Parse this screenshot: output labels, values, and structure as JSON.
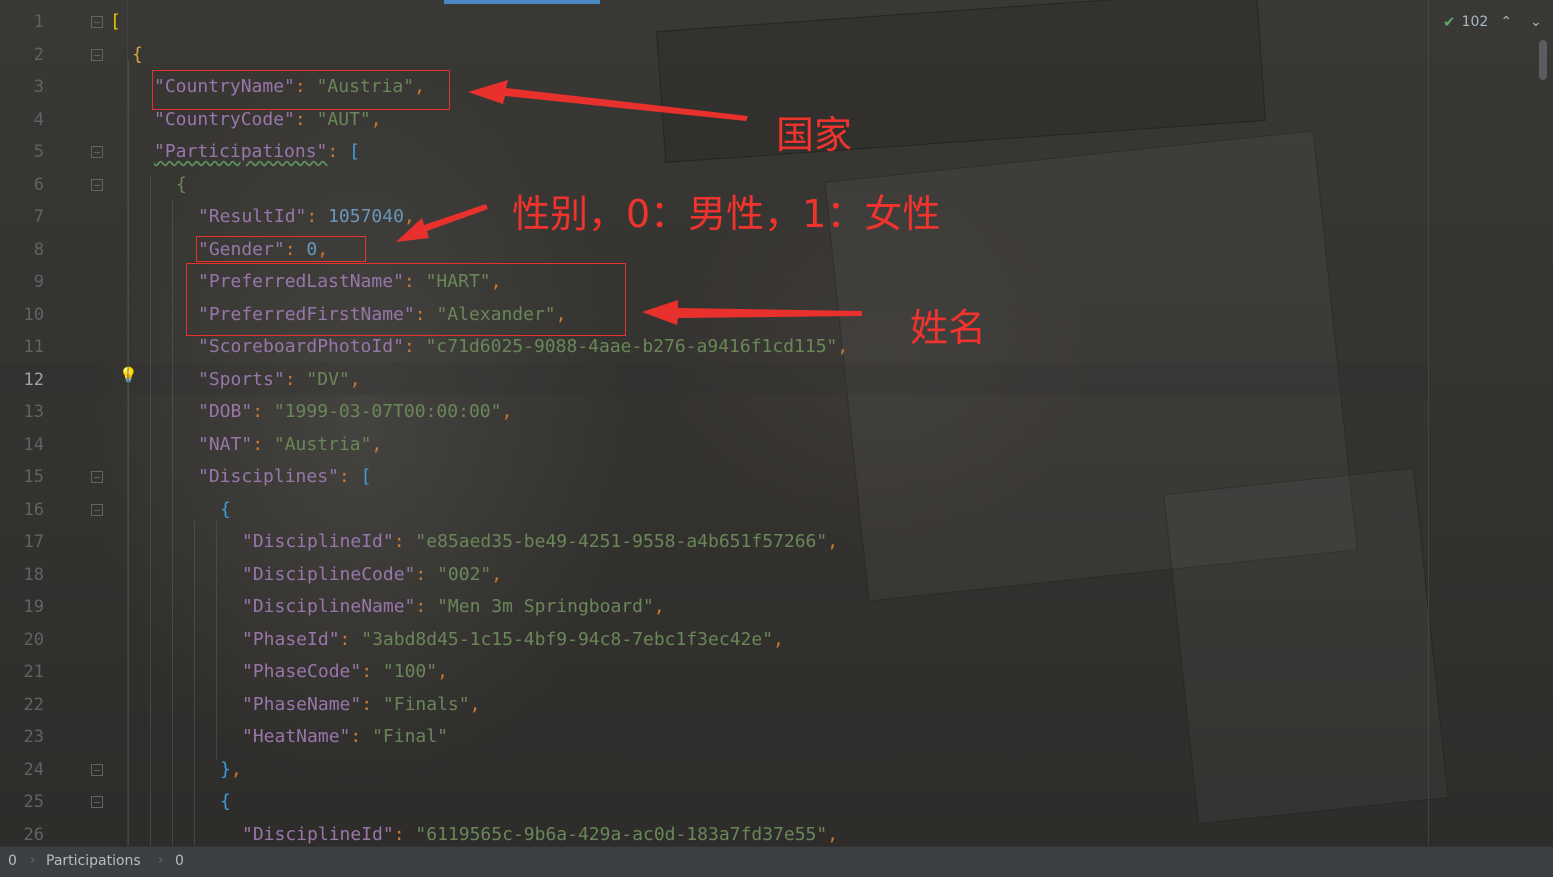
{
  "editor": {
    "line_numbers": [
      "1",
      "2",
      "3",
      "4",
      "5",
      "6",
      "7",
      "8",
      "9",
      "10",
      "11",
      "12",
      "13",
      "14",
      "15",
      "16",
      "17",
      "18",
      "19",
      "20",
      "21",
      "22",
      "23",
      "24",
      "25",
      "26"
    ],
    "current_line": "12",
    "lines": [
      {
        "indent": 0,
        "tokens": [
          {
            "t": "[",
            "c": "bracket-0"
          }
        ]
      },
      {
        "indent": 1,
        "tokens": [
          {
            "t": "{",
            "c": "bracket-1"
          }
        ]
      },
      {
        "indent": 2,
        "tokens": [
          {
            "t": "\"CountryName\"",
            "c": "key"
          },
          {
            "t": ": ",
            "c": "punct"
          },
          {
            "t": "\"Austria\"",
            "c": "str"
          },
          {
            "t": ",",
            "c": "punct"
          }
        ]
      },
      {
        "indent": 2,
        "tokens": [
          {
            "t": "\"CountryCode\"",
            "c": "key"
          },
          {
            "t": ": ",
            "c": "punct"
          },
          {
            "t": "\"AUT\"",
            "c": "str"
          },
          {
            "t": ",",
            "c": "punct"
          }
        ]
      },
      {
        "indent": 2,
        "tokens": [
          {
            "t": "\"Participations\"",
            "c": "key squiggle"
          },
          {
            "t": ": ",
            "c": "punct"
          },
          {
            "t": "[",
            "c": "bracket-2"
          }
        ]
      },
      {
        "indent": 3,
        "tokens": [
          {
            "t": "{",
            "c": "str"
          }
        ]
      },
      {
        "indent": 4,
        "tokens": [
          {
            "t": "\"ResultId\"",
            "c": "key"
          },
          {
            "t": ": ",
            "c": "punct"
          },
          {
            "t": "1057040",
            "c": "num"
          },
          {
            "t": ",",
            "c": "punct"
          }
        ]
      },
      {
        "indent": 4,
        "tokens": [
          {
            "t": "\"Gender\"",
            "c": "key"
          },
          {
            "t": ": ",
            "c": "punct"
          },
          {
            "t": "0",
            "c": "num"
          },
          {
            "t": ",",
            "c": "punct"
          }
        ]
      },
      {
        "indent": 4,
        "tokens": [
          {
            "t": "\"PreferredLastName\"",
            "c": "key"
          },
          {
            "t": ": ",
            "c": "punct"
          },
          {
            "t": "\"HART\"",
            "c": "str"
          },
          {
            "t": ",",
            "c": "punct"
          }
        ]
      },
      {
        "indent": 4,
        "tokens": [
          {
            "t": "\"PreferredFirstName\"",
            "c": "key"
          },
          {
            "t": ": ",
            "c": "punct"
          },
          {
            "t": "\"Alexander\"",
            "c": "str"
          },
          {
            "t": ",",
            "c": "punct"
          }
        ]
      },
      {
        "indent": 4,
        "tokens": [
          {
            "t": "\"ScoreboardPhotoId\"",
            "c": "key"
          },
          {
            "t": ": ",
            "c": "punct"
          },
          {
            "t": "\"c71d6025-9088-4aae-b276-a9416f1cd115\"",
            "c": "str"
          },
          {
            "t": ",",
            "c": "punct"
          }
        ]
      },
      {
        "indent": 4,
        "tokens": [
          {
            "t": "\"Sports\"",
            "c": "key"
          },
          {
            "t": ": ",
            "c": "punct"
          },
          {
            "t": "\"DV\"",
            "c": "str"
          },
          {
            "t": ",",
            "c": "punct"
          }
        ]
      },
      {
        "indent": 4,
        "tokens": [
          {
            "t": "\"DOB\"",
            "c": "key"
          },
          {
            "t": ": ",
            "c": "punct"
          },
          {
            "t": "\"1999-03-07T00:00:00\"",
            "c": "str"
          },
          {
            "t": ",",
            "c": "punct"
          }
        ]
      },
      {
        "indent": 4,
        "tokens": [
          {
            "t": "\"NAT\"",
            "c": "key"
          },
          {
            "t": ": ",
            "c": "punct"
          },
          {
            "t": "\"Austria\"",
            "c": "str"
          },
          {
            "t": ",",
            "c": "punct"
          }
        ]
      },
      {
        "indent": 4,
        "tokens": [
          {
            "t": "\"Disciplines\"",
            "c": "key"
          },
          {
            "t": ": ",
            "c": "punct"
          },
          {
            "t": "[",
            "c": "bracket-2"
          }
        ]
      },
      {
        "indent": 5,
        "tokens": [
          {
            "t": "{",
            "c": "bracket-2"
          }
        ]
      },
      {
        "indent": 6,
        "tokens": [
          {
            "t": "\"DisciplineId\"",
            "c": "key"
          },
          {
            "t": ": ",
            "c": "punct"
          },
          {
            "t": "\"e85aed35-be49-4251-9558-a4b651f57266\"",
            "c": "str"
          },
          {
            "t": ",",
            "c": "punct"
          }
        ]
      },
      {
        "indent": 6,
        "tokens": [
          {
            "t": "\"DisciplineCode\"",
            "c": "key"
          },
          {
            "t": ": ",
            "c": "punct"
          },
          {
            "t": "\"002\"",
            "c": "str"
          },
          {
            "t": ",",
            "c": "punct"
          }
        ]
      },
      {
        "indent": 6,
        "tokens": [
          {
            "t": "\"DisciplineName\"",
            "c": "key"
          },
          {
            "t": ": ",
            "c": "punct"
          },
          {
            "t": "\"Men 3m Springboard\"",
            "c": "str"
          },
          {
            "t": ",",
            "c": "punct"
          }
        ]
      },
      {
        "indent": 6,
        "tokens": [
          {
            "t": "\"PhaseId\"",
            "c": "key"
          },
          {
            "t": ": ",
            "c": "punct"
          },
          {
            "t": "\"3abd8d45-1c15-4bf9-94c8-7ebc1f3ec42e\"",
            "c": "str"
          },
          {
            "t": ",",
            "c": "punct"
          }
        ]
      },
      {
        "indent": 6,
        "tokens": [
          {
            "t": "\"PhaseCode\"",
            "c": "key"
          },
          {
            "t": ": ",
            "c": "punct"
          },
          {
            "t": "\"100\"",
            "c": "str"
          },
          {
            "t": ",",
            "c": "punct"
          }
        ]
      },
      {
        "indent": 6,
        "tokens": [
          {
            "t": "\"PhaseName\"",
            "c": "key"
          },
          {
            "t": ": ",
            "c": "punct"
          },
          {
            "t": "\"Finals\"",
            "c": "str"
          },
          {
            "t": ",",
            "c": "punct"
          }
        ]
      },
      {
        "indent": 6,
        "tokens": [
          {
            "t": "\"HeatName\"",
            "c": "key"
          },
          {
            "t": ": ",
            "c": "punct"
          },
          {
            "t": "\"Final\"",
            "c": "str"
          }
        ]
      },
      {
        "indent": 5,
        "tokens": [
          {
            "t": "}",
            "c": "bracket-2"
          },
          {
            "t": ",",
            "c": "punct"
          }
        ]
      },
      {
        "indent": 5,
        "tokens": [
          {
            "t": "{",
            "c": "bracket-2"
          }
        ]
      },
      {
        "indent": 6,
        "tokens": [
          {
            "t": "\"DisciplineId\"",
            "c": "key"
          },
          {
            "t": ": ",
            "c": "punct"
          },
          {
            "t": "\"6119565c-9b6a-429a-ac0d-183a7fd37e55\"",
            "c": "str"
          },
          {
            "t": ",",
            "c": "punct"
          }
        ]
      }
    ],
    "fold_lines": [
      "1",
      "2",
      "5",
      "6",
      "15",
      "16",
      "24",
      "25"
    ]
  },
  "inspection": {
    "count": "102",
    "icon": "check-icon",
    "colors": {
      "ok": "#59a869"
    }
  },
  "status_bar": {
    "breadcrumbs": [
      "0",
      "Participations",
      "0"
    ]
  },
  "annotations": {
    "country_label": "国家",
    "gender_label": "性别，0：男性，1：女性",
    "name_label": "姓名",
    "color": "#e8312d"
  }
}
